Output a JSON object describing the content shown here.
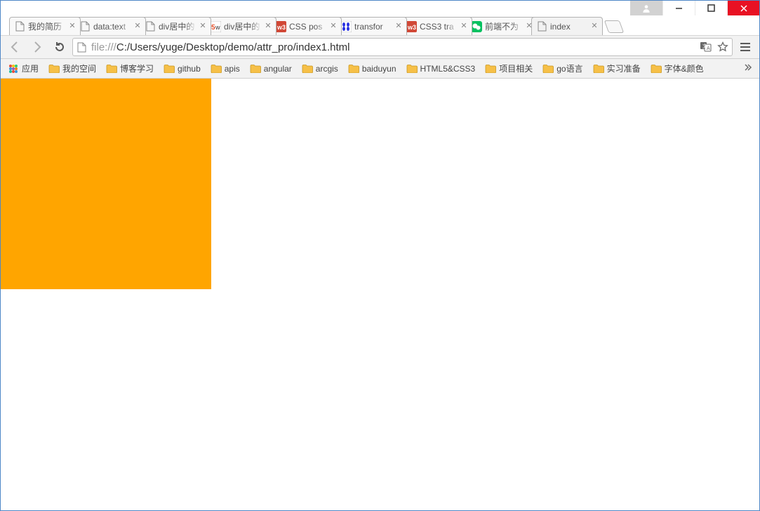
{
  "window": {
    "active_tab_index": 8
  },
  "tabs": [
    {
      "label": "我的简历",
      "favicon": "file"
    },
    {
      "label": "data:text",
      "favicon": "file"
    },
    {
      "label": "div居中的",
      "favicon": "file"
    },
    {
      "label": "div居中的",
      "favicon": "w5"
    },
    {
      "label": "CSS pos",
      "favicon": "w3"
    },
    {
      "label": "transfor",
      "favicon": "baidu"
    },
    {
      "label": "CSS3 tra",
      "favicon": "w3"
    },
    {
      "label": "前端不为",
      "favicon": "wechat"
    },
    {
      "label": "index",
      "favicon": "file"
    }
  ],
  "address": {
    "scheme": "file:///",
    "path": "C:/Users/yuge/Desktop/demo/attr_pro/index1.html"
  },
  "bookmarks": {
    "apps_label": "应用",
    "items": [
      "我的空间",
      "博客学习",
      "github",
      "apis",
      "angular",
      "arcgis",
      "baiduyun",
      "HTML5&CSS3",
      "项目相关",
      "go语言",
      "实习准备",
      "字体&颜色"
    ]
  },
  "page": {
    "box_color": "#FFA500"
  }
}
